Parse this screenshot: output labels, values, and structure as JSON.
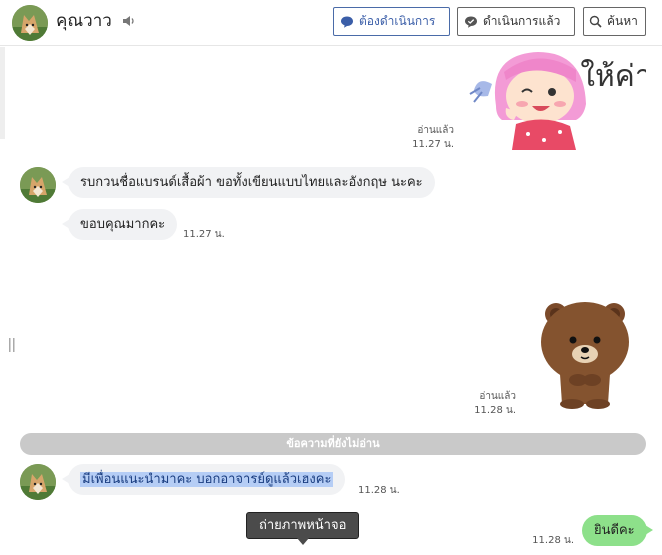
{
  "header": {
    "contact_name": "คุณวาว",
    "buttons": {
      "todo": "ต้องดำเนินการ",
      "done": "ดำเนินการแล้ว",
      "search": "ค้นหา"
    }
  },
  "messages": [
    {
      "type": "sticker",
      "from": "me",
      "sticker": "girl-thank-you",
      "text": "ให้ค่า",
      "read": "อ่านแล้ว",
      "time": "11.27 น."
    },
    {
      "type": "text",
      "from": "contact",
      "text": "รบกวนชื่อแบรนด์เสื้อผ้า ขอทั้งเขียนแบบไทยและอังกฤษ นะคะ"
    },
    {
      "type": "text",
      "from": "contact",
      "text": "ขอบคุณมากคะ",
      "time": "11.27 น."
    },
    {
      "type": "sticker",
      "from": "me",
      "sticker": "brown-bear",
      "read": "อ่านแล้ว",
      "time": "11.28 น."
    },
    {
      "type": "text",
      "from": "contact",
      "text": "มีเพื่อนแนะนำมาคะ  บอกอาจารย์ดูแล้วเฮงคะ",
      "time": "11.28 น.",
      "selected": true
    },
    {
      "type": "text",
      "from": "me",
      "text": "ยินดีคะ",
      "time": "11.28 น."
    }
  ],
  "unread_divider": "ข้อความที่ยังไม่อ่าน",
  "tooltip": "ถ่ายภาพหน้าจอ",
  "colors": {
    "accent": "#3b5ea8",
    "my_bubble": "#8de08a",
    "their_bubble": "#f1f2f4",
    "selection": "#b5cdf5"
  }
}
